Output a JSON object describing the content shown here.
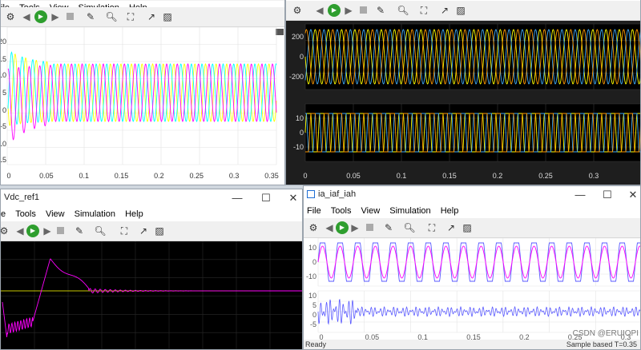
{
  "windows": {
    "top_left": {
      "menu": [
        "ile",
        "Tools",
        "View",
        "Simulation",
        "Help"
      ],
      "x_ticks": [
        "0",
        "0.05",
        "0.1",
        "0.15",
        "0.2",
        "0.25",
        "0.3",
        "0.35"
      ],
      "y_ticks": [
        "20",
        "15",
        "10",
        "5",
        "0",
        "-5",
        "-10",
        "-15"
      ]
    },
    "top_right": {
      "menu": [
        "File",
        "Tools",
        "View",
        "Simulation",
        "Help"
      ],
      "plot1_y_ticks": [
        "200",
        "0",
        "-200"
      ],
      "plot2_y_ticks": [
        "10",
        "0",
        "-10"
      ],
      "x_ticks": [
        "0",
        "0.05",
        "0.1",
        "0.15",
        "0.2",
        "0.25",
        "0.3"
      ]
    },
    "bottom_left": {
      "title": "Vdc_ref1",
      "menu": [
        "e",
        "Tools",
        "View",
        "Simulation",
        "Help"
      ]
    },
    "bottom_right": {
      "title": "ia_iaf_iah",
      "menu": [
        "File",
        "Tools",
        "View",
        "Simulation",
        "Help"
      ],
      "plot1_y_ticks": [
        "10",
        "0",
        "-10"
      ],
      "plot2_y_ticks": [
        "10",
        "5",
        "0",
        "-5"
      ],
      "x_ticks": [
        "0",
        "0.05",
        "0.1",
        "0.15",
        "0.2",
        "0.25",
        "0.3"
      ],
      "status_left": "Ready",
      "status_right": "Sample based   T=0.35",
      "watermark": "CSDN @ERUIOPI"
    }
  },
  "colors": {
    "yellow": "#ffff00",
    "cyan": "#00ffff",
    "magenta": "#ff00ff",
    "orange": "#ff9900",
    "blue_cyan": "#3fa9f5",
    "wave_line": "#5a5aff",
    "ref_line": "#c8c800"
  }
}
